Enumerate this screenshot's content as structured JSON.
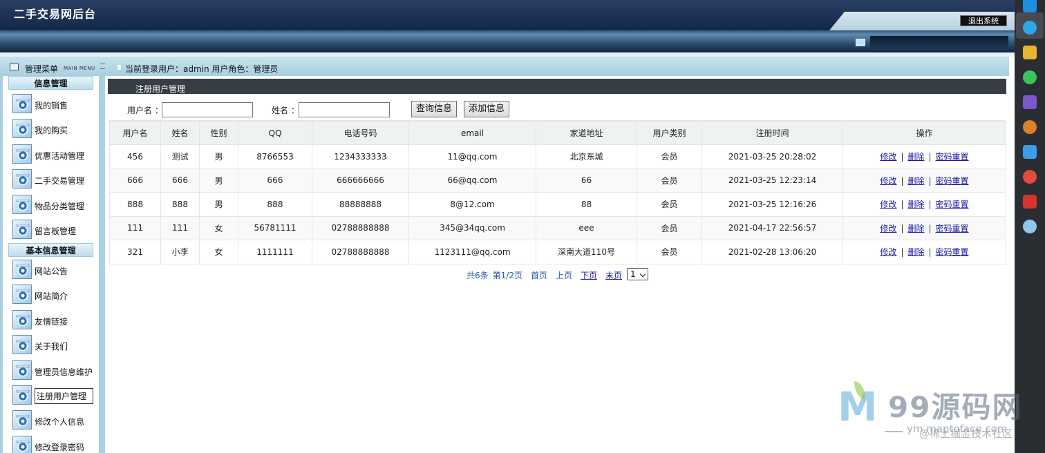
{
  "app": {
    "title": "二手交易网后台",
    "logout_label": "退出系统"
  },
  "sidebar": {
    "header_title": "管理菜单",
    "header_subtitle": "MAIN MENU",
    "groups": [
      {
        "title": "信息管理",
        "items": [
          {
            "label": "我的销售"
          },
          {
            "label": "我的购买"
          },
          {
            "label": "优惠活动管理"
          },
          {
            "label": "二手交易管理"
          },
          {
            "label": "物品分类管理"
          },
          {
            "label": "留言板管理"
          }
        ]
      },
      {
        "title": "基本信息管理",
        "items": [
          {
            "label": "网站公告"
          },
          {
            "label": "网站简介"
          },
          {
            "label": "友情链接"
          },
          {
            "label": "关于我们"
          },
          {
            "label": "管理员信息维护"
          },
          {
            "label": "注册用户管理",
            "active": true
          },
          {
            "label": "修改个人信息"
          },
          {
            "label": "修改登录密码"
          }
        ]
      }
    ]
  },
  "session": {
    "text": "当前登录用户：admin  用户角色：管理员"
  },
  "page": {
    "section_title": "注册用户管理"
  },
  "search": {
    "username_label": "用户名 ：",
    "username_value": "",
    "name_label": "姓名 ：",
    "name_value": "",
    "query_button": "查询信息",
    "add_button": "添加信息"
  },
  "table": {
    "columns": [
      "用户名",
      "姓名",
      "性别",
      "QQ",
      "电话号码",
      "email",
      "家道地址",
      "用户类别",
      "注册时间",
      "操作"
    ],
    "rows": [
      [
        "456",
        "测试",
        "男",
        "8766553",
        "1234333333",
        "11@qq.com",
        "北京东城",
        "会员",
        "2021-03-25 20:28:02"
      ],
      [
        "666",
        "666",
        "男",
        "666",
        "666666666",
        "66@qq.com",
        "66",
        "会员",
        "2021-03-25 12:23:14"
      ],
      [
        "888",
        "888",
        "男",
        "888",
        "88888888",
        "8@12.com",
        "88",
        "会员",
        "2021-03-25 12:16:26"
      ],
      [
        "111",
        "111",
        "女",
        "56781111",
        "02788888888",
        "345@34qq.com",
        "eee",
        "会员",
        "2021-04-17 22:56:57"
      ],
      [
        "321",
        "小李",
        "女",
        "1111111",
        "02788888888",
        "1123111@qq.com",
        "深南大道110号",
        "会员",
        "2021-02-28 13:06:20"
      ]
    ],
    "actions": {
      "edit": "修改",
      "delete": "删除",
      "reset": "密码重置",
      "sep": "|"
    }
  },
  "pagination": {
    "total": "共6条",
    "page_info": "第1/2页",
    "first": "首页",
    "prev": "上页",
    "next": "下页",
    "last": "末页",
    "selected_page": "1"
  },
  "taskbar": {
    "icons": [
      "p-app-icon",
      "edge-browser-icon",
      "file-explorer-icon",
      "wechat-icon",
      "visual-studio-icon",
      "settings-gear-icon",
      "cloud-drive-icon",
      "chrome-icon",
      "wps-icon",
      "flower-app-icon"
    ]
  },
  "watermark": {
    "brand": "99源码网",
    "url": "ym.maptoface.com",
    "credit": "@稀土掘金技术社区"
  }
}
